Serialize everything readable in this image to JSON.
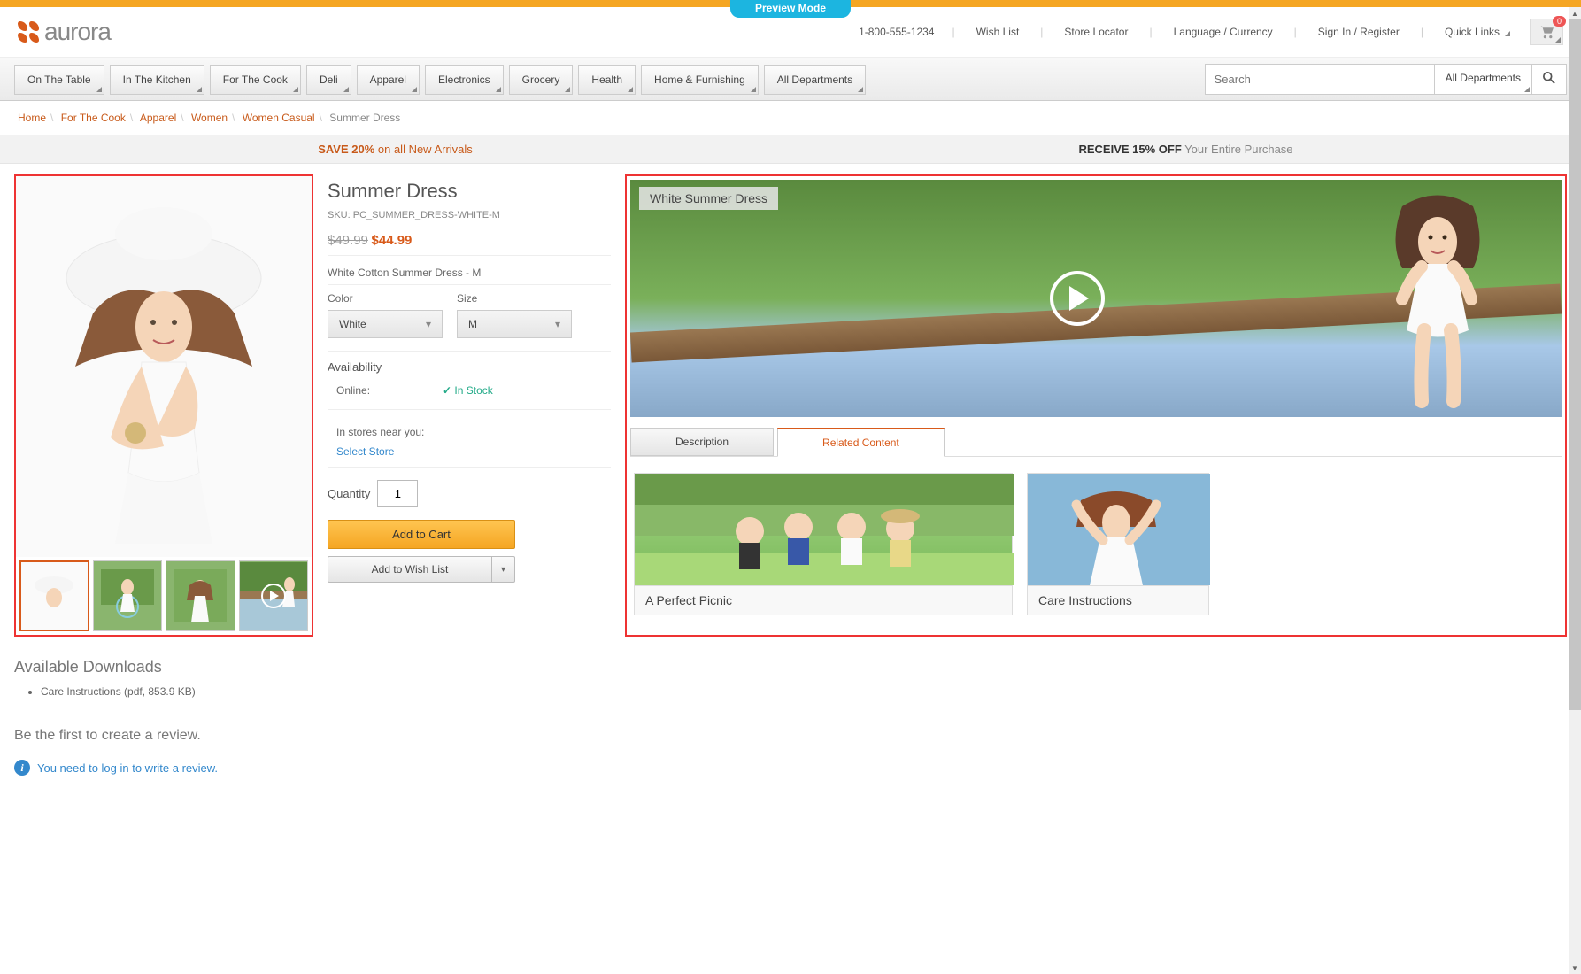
{
  "preview_label": "Preview Mode",
  "logo": "aurora",
  "phone": "1-800-555-1234",
  "header_links": {
    "wish": "Wish List",
    "store_loc": "Store Locator",
    "lang": "Language / Currency",
    "signin": "Sign In / Register",
    "quick": "Quick Links"
  },
  "cart_count": "0",
  "nav": [
    "On The Table",
    "In The Kitchen",
    "For The Cook",
    "Deli",
    "Apparel",
    "Electronics",
    "Grocery",
    "Health",
    "Home & Furnishing",
    "All Departments"
  ],
  "search": {
    "placeholder": "Search",
    "dept": "All Departments"
  },
  "breadcrumbs": {
    "links": [
      "Home",
      "For The Cook",
      "Apparel",
      "Women",
      "Women Casual"
    ],
    "current": "Summer Dress"
  },
  "promo": {
    "left_bold": "SAVE 20%",
    "left_rest": " on all New Arrivals",
    "right_bold": "RECEIVE 15% OFF",
    "right_rest": " Your Entire Purchase"
  },
  "product": {
    "title": "Summer Dress",
    "sku": "SKU: PC_SUMMER_DRESS-WHITE-M",
    "old_price": "$49.99",
    "new_price": "$44.99",
    "desc": "White Cotton Summer Dress - M",
    "color_label": "Color",
    "color_val": "White",
    "size_label": "Size",
    "size_val": "M",
    "avail_label": "Availability",
    "online_label": "Online:",
    "instock": "In Stock",
    "stores_label": "In stores near you:",
    "select_store": "Select Store",
    "qty_label": "Quantity",
    "qty_val": "1",
    "add_cart": "Add to Cart",
    "add_wish": "Add to Wish List"
  },
  "video_label": "White Summer Dress",
  "tabs": {
    "desc": "Description",
    "related": "Related Content"
  },
  "related": [
    {
      "title": "A Perfect Picnic"
    },
    {
      "title": "Care Instructions"
    }
  ],
  "downloads": {
    "title": "Available Downloads",
    "items": [
      "Care Instructions (pdf, 853.9 KB)"
    ]
  },
  "review": {
    "title": "Be the first to create a review.",
    "note": "You need to log in to write a review."
  }
}
